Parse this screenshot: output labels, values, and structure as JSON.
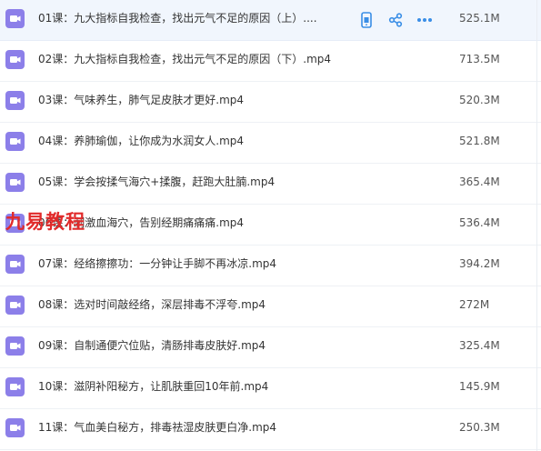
{
  "files": [
    {
      "name": "01课：九大指标自我检查，找出元气不足的原因（上）....",
      "size": "525.1M",
      "icon": "video-file-icon"
    },
    {
      "name": "02课：九大指标自我检查，找出元气不足的原因（下）.mp4",
      "size": "713.5M",
      "icon": "video-file-icon"
    },
    {
      "name": "03课：气味养生，肺气足皮肤才更好.mp4",
      "size": "520.3M",
      "icon": "video-file-icon"
    },
    {
      "name": "04课：养肺瑜伽，让你成为水润女人.mp4",
      "size": "521.8M",
      "icon": "video-file-icon"
    },
    {
      "name": "05课：学会按揉气海穴+揉腹，赶跑大肚腩.mp4",
      "size": "365.4M",
      "icon": "video-file-icon"
    },
    {
      "name": "06课：刺激血海穴，告别经期痛痛痛.mp4",
      "size": "536.4M",
      "icon": "video-file-icon"
    },
    {
      "name": "07课：经络擦擦功：一分钟让手脚不再冰凉.mp4",
      "size": "394.2M",
      "icon": "video-file-icon"
    },
    {
      "name": "08课：选对时间敲经络，深层排毒不浮夸.mp4",
      "size": "272M",
      "icon": "video-file-icon"
    },
    {
      "name": "09课：自制通便穴位贴，清肠排毒皮肤好.mp4",
      "size": "325.4M",
      "icon": "video-file-icon"
    },
    {
      "name": "10课：滋阴补阳秘方，让肌肤重回10年前.mp4",
      "size": "145.9M",
      "icon": "video-file-icon"
    },
    {
      "name": "11课：气血美白秘方，排毒祛湿皮肤更白净.mp4",
      "size": "250.3M",
      "icon": "video-file-icon"
    }
  ],
  "row_actions": {
    "icons": [
      "phone-icon",
      "share-icon",
      "more-icon"
    ]
  },
  "watermark": {
    "text": "九易教程"
  },
  "colors": {
    "file_icon": "#8c7fe9",
    "action_icon": "#3a8ee6",
    "watermark": "#e12b2b",
    "hover_row": "#f1f6fd"
  }
}
